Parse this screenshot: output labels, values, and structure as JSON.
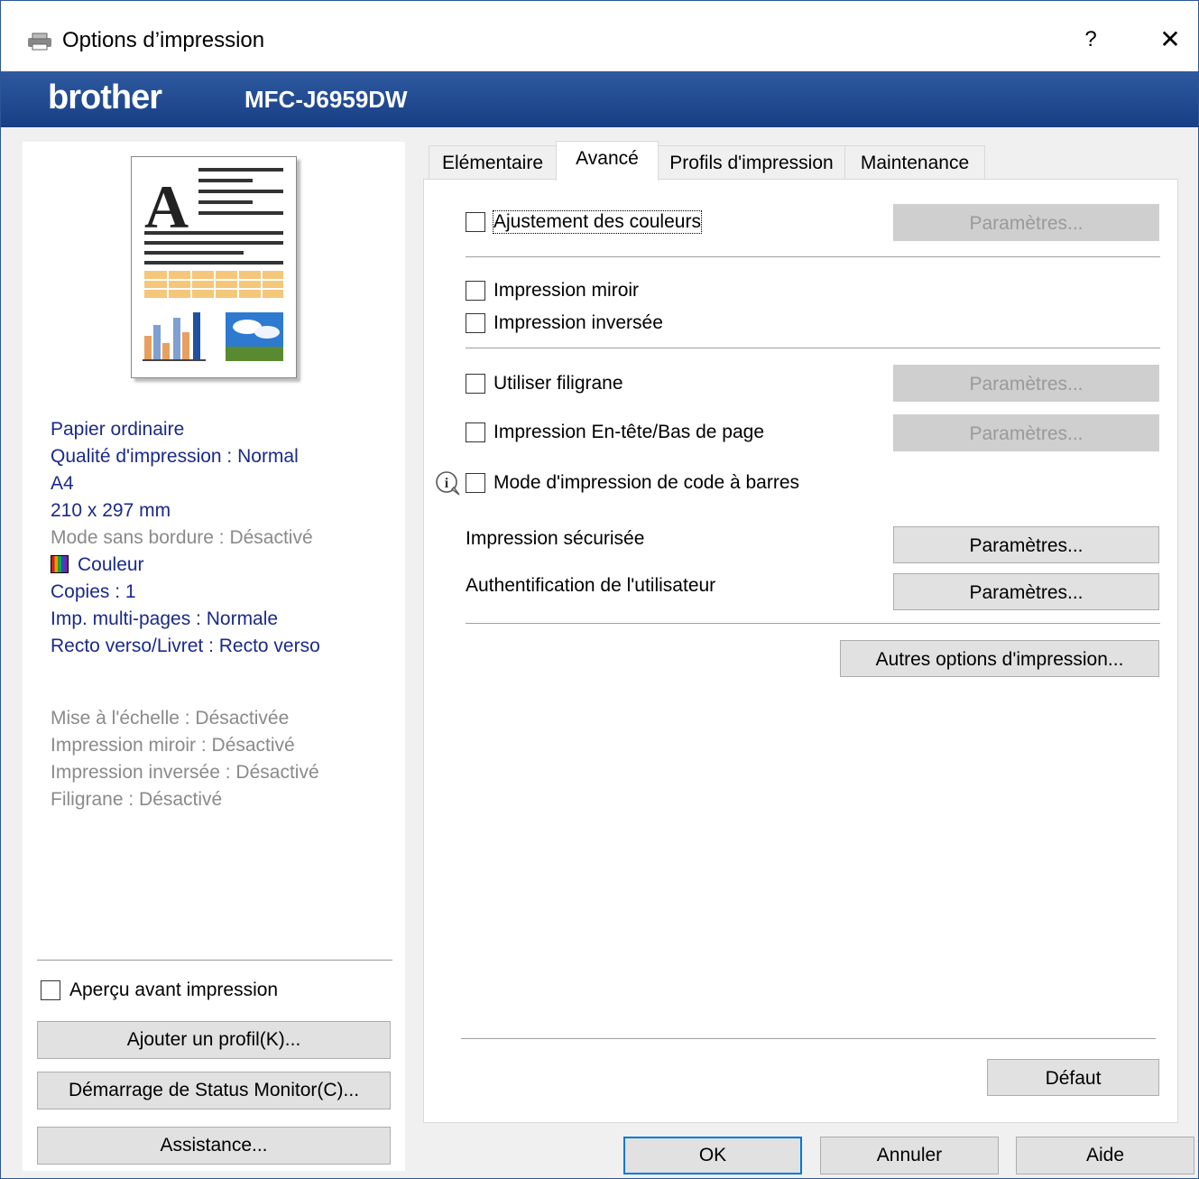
{
  "window": {
    "title": "Options d’impression",
    "help": "?",
    "close": "✕",
    "brand": "brother",
    "model": "MFC-J6959DW"
  },
  "tabs": [
    {
      "label": "Elémentaire",
      "active": false
    },
    {
      "label": "Avancé",
      "active": true
    },
    {
      "label": "Profils d'impression",
      "active": false
    },
    {
      "label": "Maintenance",
      "active": false
    }
  ],
  "summary": {
    "paper_type": "Papier ordinaire",
    "quality": "Qualité d'impression : Normal",
    "size": "A4",
    "dimensions": "210 x 297 mm",
    "borderless": "Mode sans bordure : Désactivé",
    "color": "Couleur",
    "copies": "Copies : 1",
    "multipage": "Imp. multi-pages : Normale",
    "duplex": "Recto verso/Livret : Recto verso",
    "scaling": "Mise à l'échelle : Désactivée",
    "mirror": "Impression miroir : Désactivé",
    "reverse": "Impression inversée : Désactivé",
    "watermark": "Filigrane : Désactivé"
  },
  "left_controls": {
    "preview_checkbox": "Aperçu avant impression",
    "add_profile": "Ajouter un profil(K)...",
    "status_monitor": "Démarrage de Status Monitor(C)...",
    "support": "Assistance..."
  },
  "advanced": {
    "color_adjust": "Ajustement des couleurs",
    "mirror_print": "Impression miroir",
    "reverse_print": "Impression inversée",
    "use_watermark": "Utiliser filigrane",
    "header_footer": "Impression En-tête/Bas de page",
    "barcode_mode": "Mode d'impression de code à barres",
    "secure_print": "Impression sécurisée",
    "user_auth": "Authentification de l'utilisateur",
    "settings_button": "Paramètres...",
    "other_options": "Autres options d'impression...",
    "default": "Défaut",
    "info_icon": "info-icon"
  },
  "footer": {
    "ok": "OK",
    "cancel": "Annuler",
    "help": "Aide"
  }
}
